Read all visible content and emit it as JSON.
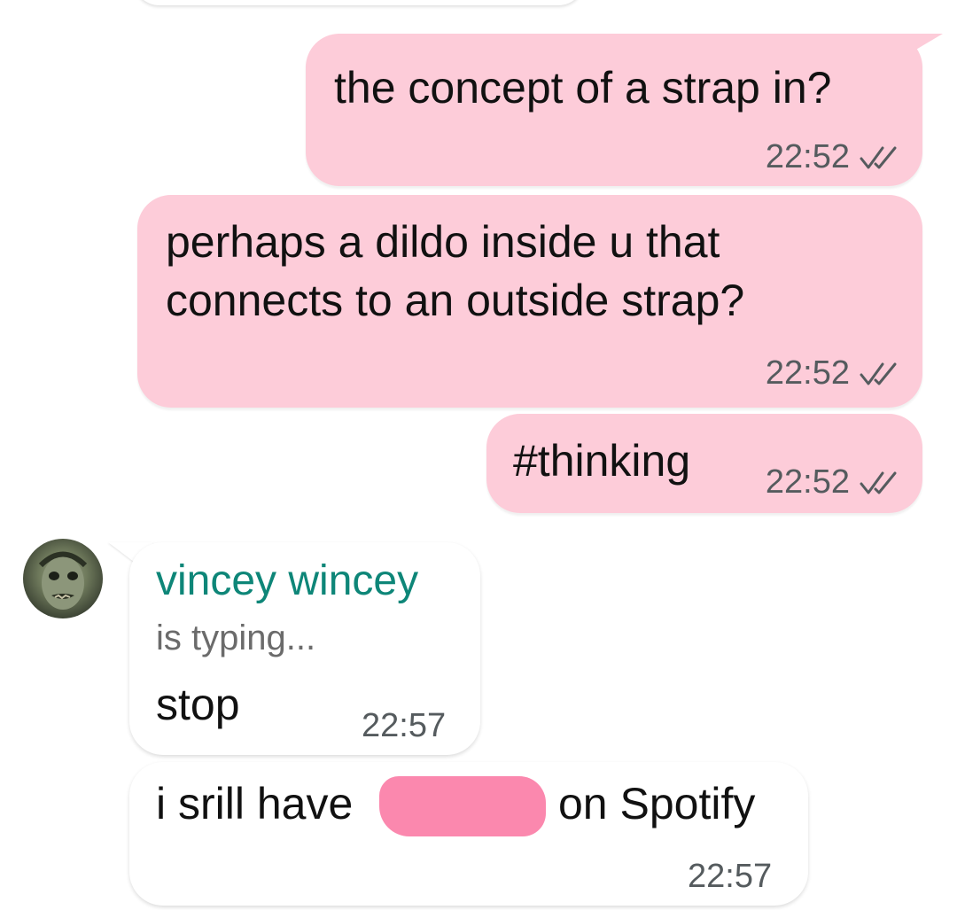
{
  "messages": [
    {
      "direction": "outgoing",
      "text": "the concept of a strap in?",
      "time": "22:52",
      "status_icon": "double-check-icon"
    },
    {
      "direction": "outgoing",
      "lines": [
        "perhaps a dildo inside u that",
        "connects to an outside strap?"
      ],
      "time": "22:52",
      "status_icon": "double-check-icon"
    },
    {
      "direction": "outgoing",
      "text": "#thinking",
      "time": "22:52",
      "status_icon": "double-check-icon"
    },
    {
      "direction": "incoming",
      "sender": "vincey wincey",
      "status": "is typing...",
      "text": "stop",
      "time": "22:57"
    },
    {
      "direction": "incoming",
      "text_before": "i srill have",
      "text_after": "on Spotify",
      "time": "22:57"
    }
  ],
  "colors": {
    "outgoing_bubble": "#fdccd9",
    "incoming_bubble": "#ffffff",
    "sender_name": "#0e8678",
    "redaction": "#fb88ae",
    "ticks": "#555b5e"
  }
}
